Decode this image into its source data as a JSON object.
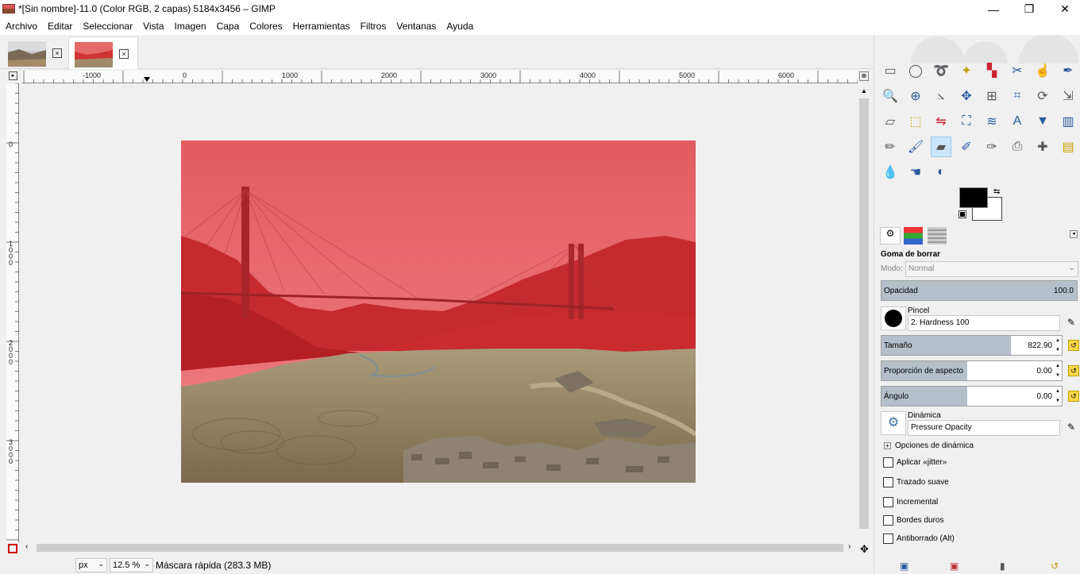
{
  "window": {
    "title": "*[Sin nombre]-11.0 (Color RGB, 2 capas) 5184x3456 – GIMP",
    "minimize": "—",
    "maximize": "❐",
    "close": "✕"
  },
  "menu": [
    "Archivo",
    "Editar",
    "Seleccionar",
    "Vista",
    "Imagen",
    "Capa",
    "Colores",
    "Herramientas",
    "Filtros",
    "Ventanas",
    "Ayuda"
  ],
  "tabs": [
    {
      "close": "×"
    },
    {
      "close": "×"
    }
  ],
  "ruler": {
    "h_labels": [
      "-1000",
      "0",
      "1000",
      "2000",
      "3000",
      "4000",
      "5000",
      "6000"
    ],
    "v_labels": [
      "0",
      "1000",
      "2000",
      "3000"
    ]
  },
  "status": {
    "unit": "px",
    "zoom": "12.5 %",
    "message": "Máscara rápida (283.3 MB)"
  },
  "colors": {
    "mask_red": "#e21f26",
    "foreground": "#000000",
    "background": "#ffffff"
  },
  "tools": [
    "rect-select-icon",
    "ellipse-select-icon",
    "free-select-icon",
    "fuzzy-select-icon",
    "select-by-color-icon",
    "scissors-icon",
    "foreground-select-icon",
    "paths-icon",
    "color-picker-icon",
    "zoom-icon",
    "measure-icon",
    "move-icon",
    "align-icon",
    "crop-icon",
    "rotate-icon",
    "scale-icon",
    "shear-icon",
    "perspective-icon",
    "flip-icon",
    "cage-icon",
    "warp-icon",
    "text-icon",
    "bucket-fill-icon",
    "gradient-icon",
    "pencil-icon",
    "paintbrush-icon",
    "eraser-icon",
    "airbrush-icon",
    "ink-icon",
    "clone-icon",
    "heal-icon",
    "perspective-clone-icon",
    "blur-icon",
    "smudge-icon",
    "dodge-burn-icon"
  ],
  "tool_options": {
    "title": "Goma de borrar",
    "mode_label": "Modo:",
    "mode_value": "Normal",
    "opacity_label": "Opacidad",
    "opacity_value": "100.0",
    "brush_label": "Pincel",
    "brush_value": "2. Hardness 100",
    "size_label": "Tamaño",
    "size_value": "822.90",
    "aspect_label": "Proporción de aspecto",
    "aspect_value": "0.00",
    "angle_label": "Ángulo",
    "angle_value": "0.00",
    "dynamics_label": "Dinámica",
    "dynamics_value": "Pressure Opacity",
    "dynamics_options": "Opciones de dinámica",
    "jitter": "Aplicar «jitter»",
    "smooth": "Trazado suave",
    "incremental": "Incremental",
    "hard_edges": "Bordes duros",
    "anti_erase": "Antiborrado  (Alt)"
  },
  "progress": {
    "opacity_fraction": 1.0,
    "size_fraction": 0.72
  }
}
